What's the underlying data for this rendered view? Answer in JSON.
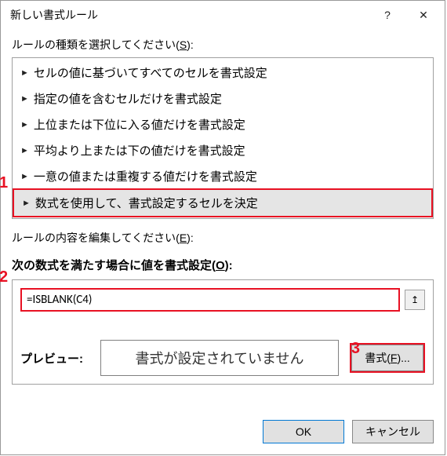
{
  "title": "新しい書式ルール",
  "titlebar": {
    "help": "?",
    "close": "✕"
  },
  "ruleTypeLabel": "ルールの種類を選択してください(",
  "ruleTypeKey": "S",
  "ruleTypeLabelEnd": "):",
  "ruleTypes": [
    "セルの値に基づいてすべてのセルを書式設定",
    "指定の値を含むセルだけを書式設定",
    "上位または下位に入る値だけを書式設定",
    "平均より上または下の値だけを書式設定",
    "一意の値または重複する値だけを書式設定",
    "数式を使用して、書式設定するセルを決定"
  ],
  "markers": {
    "m1": "1",
    "m2": "2",
    "m3": "3"
  },
  "editLabel": "ルールの内容を編集してください(",
  "editKey": "E",
  "editLabelEnd": "):",
  "formulaLabel": "次の数式を満たす場合に値を書式設定(",
  "formulaKey": "O",
  "formulaLabelEnd": "):",
  "formulaValue": "=ISBLANK(C4)",
  "refIcon": "↥",
  "previewLabel": "プレビュー:",
  "previewText": "書式が設定されていません",
  "formatBtn": "書式(",
  "formatKey": "F",
  "formatBtnEnd": ")...",
  "ok": "OK",
  "cancel": "キャンセル"
}
